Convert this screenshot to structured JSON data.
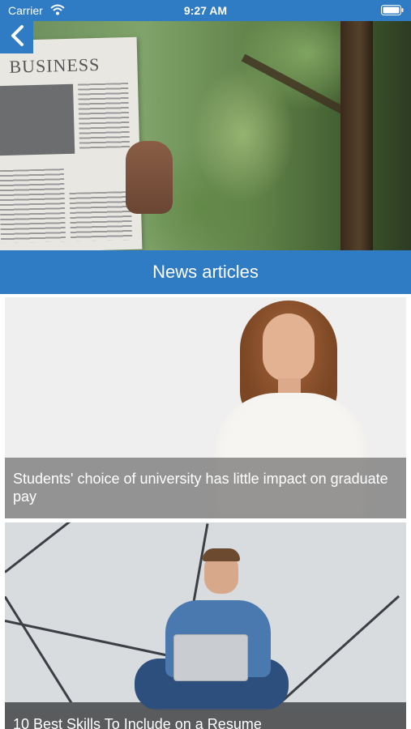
{
  "status_bar": {
    "carrier": "Carrier",
    "time": "9:27 AM",
    "icons": [
      "wifi-icon",
      "battery-icon"
    ]
  },
  "hero": {
    "newspaper_masthead": "BUSINESS",
    "back_icon": "chevron-left-icon"
  },
  "section": {
    "title": "News articles"
  },
  "articles": [
    {
      "title": "Students' choice of university has little impact on graduate pay"
    },
    {
      "title": "10 Best Skills To Include on a Resume"
    }
  ],
  "colors": {
    "accent": "#2f7bc4",
    "caption_overlay": "rgba(90,90,90,0.62)",
    "text_on_accent": "#ffffff"
  }
}
